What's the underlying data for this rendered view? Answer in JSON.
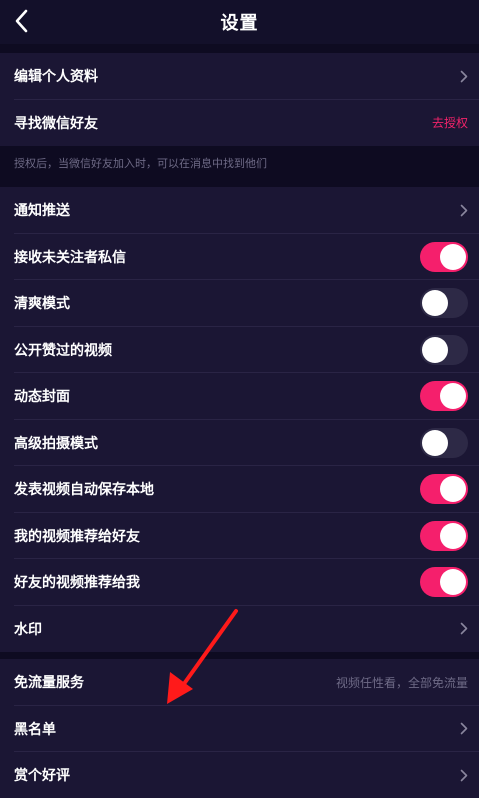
{
  "header": {
    "title": "设置"
  },
  "rows": {
    "edit_profile": "编辑个人资料",
    "find_wechat": "寻找微信好友",
    "authorize": "去授权",
    "auth_note": "授权后，当微信好友加入时，可以在消息中找到他们",
    "notifications": "通知推送",
    "stranger_messages": "接收未关注者私信",
    "fresh_mode": "清爽模式",
    "public_likes": "公开赞过的视频",
    "dynamic_cover": "动态封面",
    "advanced_shoot": "高级拍摄模式",
    "auto_save": "发表视频自动保存本地",
    "recommend_to_friends": "我的视频推荐给好友",
    "friends_recommend_me": "好友的视频推荐给我",
    "watermark": "水印",
    "free_data": "免流量服务",
    "free_data_hint": "视频任性看，全部免流量",
    "blacklist": "黑名单",
    "rate": "赏个好评"
  },
  "toggles": {
    "stranger_messages": true,
    "fresh_mode": false,
    "public_likes": false,
    "dynamic_cover": true,
    "advanced_shoot": false,
    "auto_save": true,
    "recommend_to_friends": true,
    "friends_recommend_me": true
  },
  "colors": {
    "accent": "#f51f6c",
    "background": "#13102a",
    "row_bg": "#1b1634",
    "annotation_arrow": "#ff1a1a"
  }
}
